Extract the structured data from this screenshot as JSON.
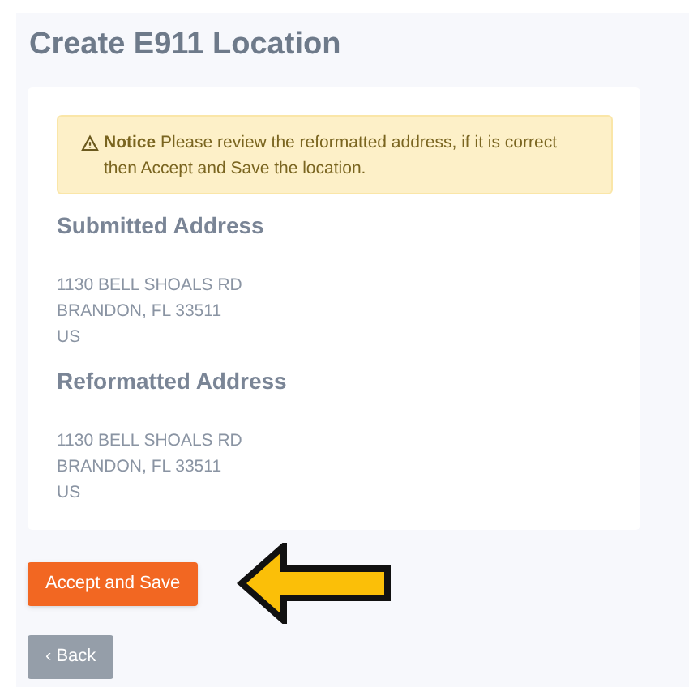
{
  "page": {
    "title": "Create E911 Location"
  },
  "notice": {
    "text": "**Notice** Please review the reformatted address, if it is correct then Accept and Save the location."
  },
  "sections": [
    {
      "heading": "Submitted Address",
      "lines": [
        "1130 BELL SHOALS RD",
        "BRANDON, FL 33511",
        "US"
      ]
    },
    {
      "heading": "Reformatted Address",
      "lines": [
        "1130 BELL SHOALS RD",
        "BRANDON, FL 33511",
        "US"
      ]
    }
  ],
  "buttons": [
    {
      "label": "Accept and Save",
      "kind": "primary"
    },
    {
      "label": "‹ Back",
      "kind": "secondary"
    }
  ]
}
